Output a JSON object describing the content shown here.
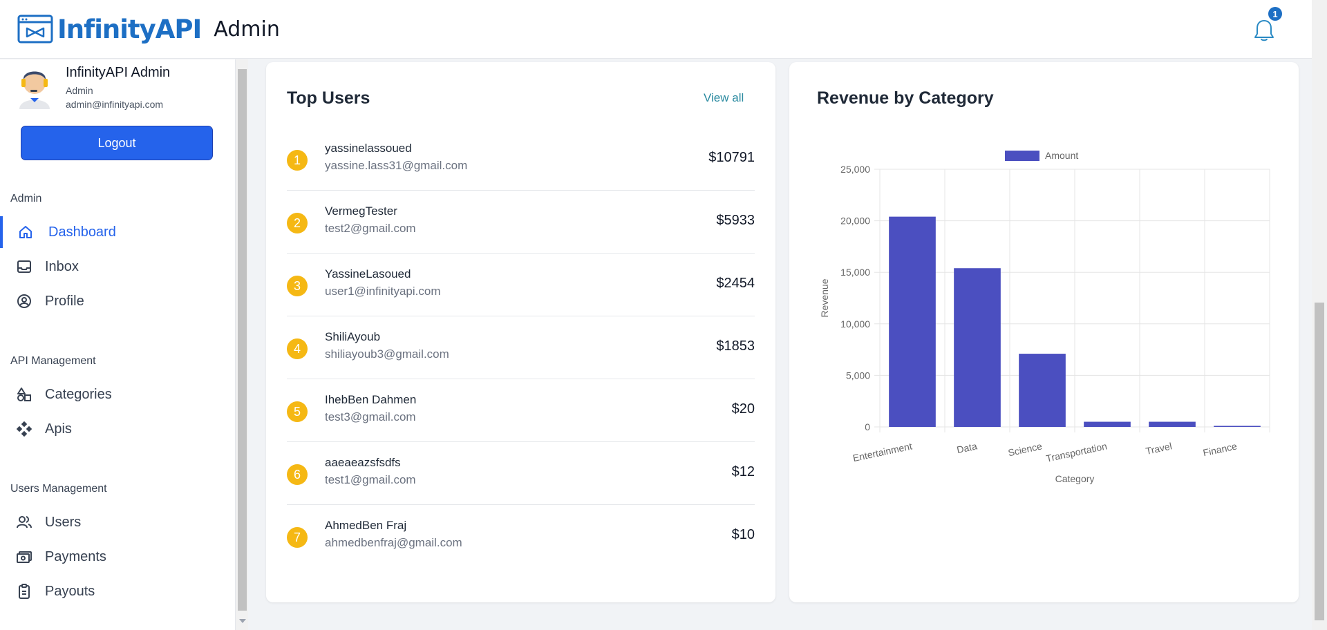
{
  "header": {
    "brand": "InfinityAPI",
    "section": "Admin",
    "notification_count": "1"
  },
  "sidebar": {
    "profile": {
      "name": "InfinityAPI Admin",
      "role": "Admin",
      "email": "admin@infinityapi.com"
    },
    "logout_label": "Logout",
    "sections": {
      "admin": "Admin",
      "api": "API Management",
      "users": "Users Management"
    },
    "items": {
      "dashboard": "Dashboard",
      "inbox": "Inbox",
      "profile": "Profile",
      "categories": "Categories",
      "apis": "Apis",
      "users": "Users",
      "payments": "Payments",
      "payouts": "Payouts"
    }
  },
  "top_users": {
    "title": "Top Users",
    "view_all": "View all",
    "rows": [
      {
        "rank": "1",
        "name": "yassinelassoued",
        "email": "yassine.lass31@gmail.com",
        "amount": "$10791"
      },
      {
        "rank": "2",
        "name": "VermegTester",
        "email": "test2@gmail.com",
        "amount": "$5933"
      },
      {
        "rank": "3",
        "name": "YassineLasoued",
        "email": "user1@infinityapi.com",
        "amount": "$2454"
      },
      {
        "rank": "4",
        "name": "ShiliAyoub",
        "email": "shiliayoub3@gmail.com",
        "amount": "$1853"
      },
      {
        "rank": "5",
        "name": "IhebBen Dahmen",
        "email": "test3@gmail.com",
        "amount": "$20"
      },
      {
        "rank": "6",
        "name": "aaeaeazsfsdfs",
        "email": "test1@gmail.com",
        "amount": "$12"
      },
      {
        "rank": "7",
        "name": "AhmedBen Fraj",
        "email": "ahmedbenfraj@gmail.com",
        "amount": "$10"
      }
    ]
  },
  "revenue": {
    "title": "Revenue by Category"
  },
  "chart_data": {
    "type": "bar",
    "title": "Revenue by Category",
    "categories": [
      "Entertainment",
      "Data",
      "Science",
      "Transportation",
      "Travel",
      "Finance"
    ],
    "series": [
      {
        "name": "Amount",
        "values": [
          20400,
          15400,
          7100,
          500,
          500,
          100
        ],
        "color": "#4b4fc0"
      }
    ],
    "xlabel": "Category",
    "ylabel": "Revenue",
    "ylim": [
      0,
      25000
    ],
    "yticks": [
      "0",
      "5,000",
      "10,000",
      "15,000",
      "20,000",
      "25,000"
    ],
    "grid": true,
    "legend": "top"
  },
  "colors": {
    "primary": "#2563eb",
    "brand": "#1d6fc4",
    "rank_badge": "#f5b814",
    "bar": "#4b4fc0"
  }
}
